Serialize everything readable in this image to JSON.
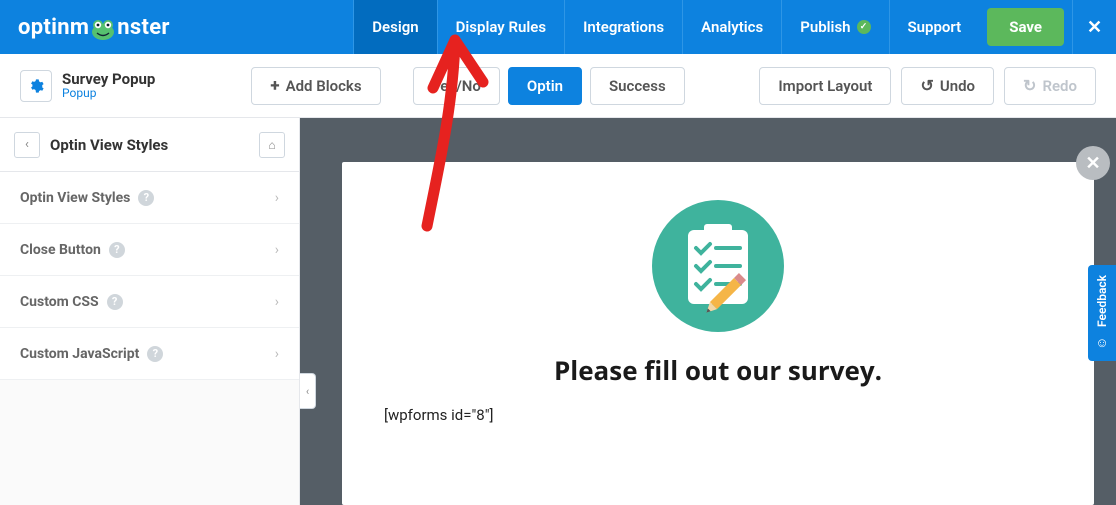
{
  "brand": {
    "name_pre": "optinm",
    "name_post": "nster"
  },
  "nav": {
    "design": "Design",
    "display_rules": "Display Rules",
    "integrations": "Integrations",
    "analytics": "Analytics",
    "publish": "Publish",
    "support": "Support",
    "save": "Save",
    "close": "✕"
  },
  "campaign": {
    "title": "Survey Popup",
    "type": "Popup"
  },
  "toolbar": {
    "add_blocks": "Add Blocks",
    "views": {
      "yesno": "Yes/No",
      "optin": "Optin",
      "success": "Success"
    },
    "import_layout": "Import Layout",
    "undo": "Undo",
    "redo": "Redo"
  },
  "sidebar": {
    "header": "Optin View Styles",
    "items": [
      {
        "label": "Optin View Styles"
      },
      {
        "label": "Close Button"
      },
      {
        "label": "Custom CSS"
      },
      {
        "label": "Custom JavaScript"
      }
    ]
  },
  "popup": {
    "heading": "Please fill out our survey.",
    "shortcode": "[wpforms id=\"8\"]"
  },
  "feedback": {
    "label": "Feedback"
  }
}
